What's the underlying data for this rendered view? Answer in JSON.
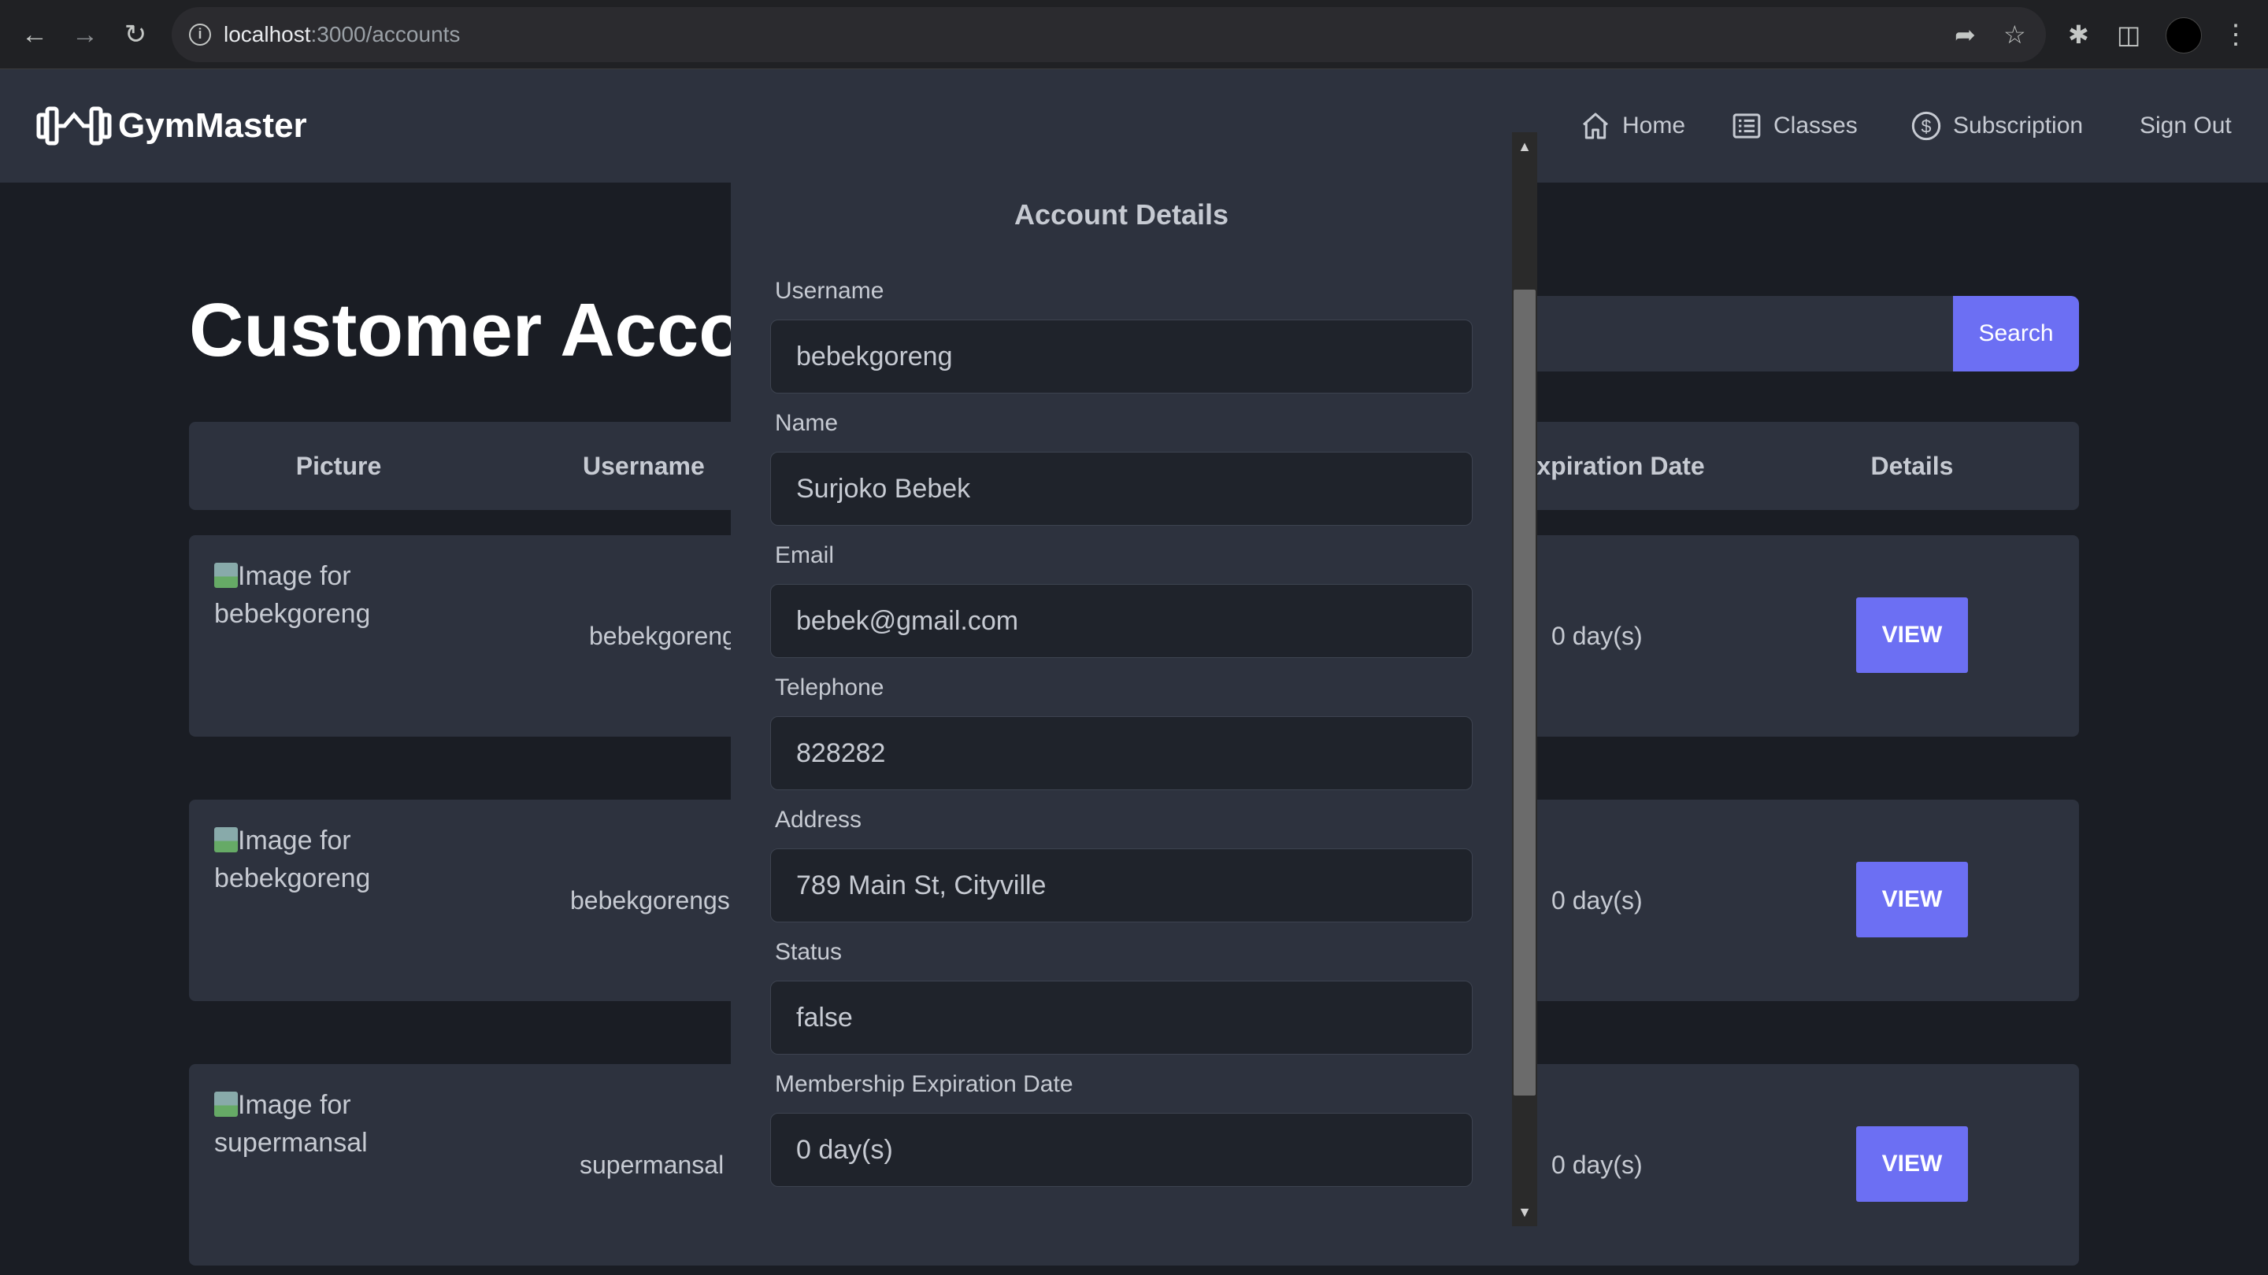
{
  "browser": {
    "url_host": "localhost",
    "url_path": ":3000/accounts"
  },
  "app": {
    "brand": "GymMaster",
    "nav": [
      {
        "label": "Home",
        "icon": "home-icon"
      },
      {
        "label": "Classes",
        "icon": "list-icon"
      },
      {
        "label": "Subscription",
        "icon": "dollar-icon"
      },
      {
        "label": "Sign Out"
      }
    ]
  },
  "page": {
    "title": "Customer Accounts",
    "search_button": "Search"
  },
  "table": {
    "headers": [
      "Picture",
      "Username",
      "Expiration Date",
      "Details"
    ],
    "rows": [
      {
        "picture_alt": "Image for bebekgoreng",
        "username": "bebekgoreng",
        "expiration": "0 day(s)",
        "action": "VIEW"
      },
      {
        "picture_alt": "Image for bebekgorengs",
        "username": "bebekgorengs",
        "expiration": "0 day(s)",
        "action": "VIEW"
      },
      {
        "picture_alt": "Image for supermansal",
        "username": "supermansal",
        "expiration": "0 day(s)",
        "action": "VIEW"
      }
    ]
  },
  "modal": {
    "title": "Account Details",
    "fields": [
      {
        "label": "Username",
        "value": "bebekgoreng"
      },
      {
        "label": "Name",
        "value": "Surjoko Bebek"
      },
      {
        "label": "Email",
        "value": "bebek@gmail.com"
      },
      {
        "label": "Telephone",
        "value": "828282"
      },
      {
        "label": "Address",
        "value": "789 Main St, Cityville"
      },
      {
        "label": "Status",
        "value": "false"
      },
      {
        "label": "Membership Expiration Date",
        "value": "0 day(s)"
      }
    ]
  },
  "colors": {
    "accent": "#6c6ff3",
    "surface": "#2d323e",
    "background": "#1a1d24"
  }
}
